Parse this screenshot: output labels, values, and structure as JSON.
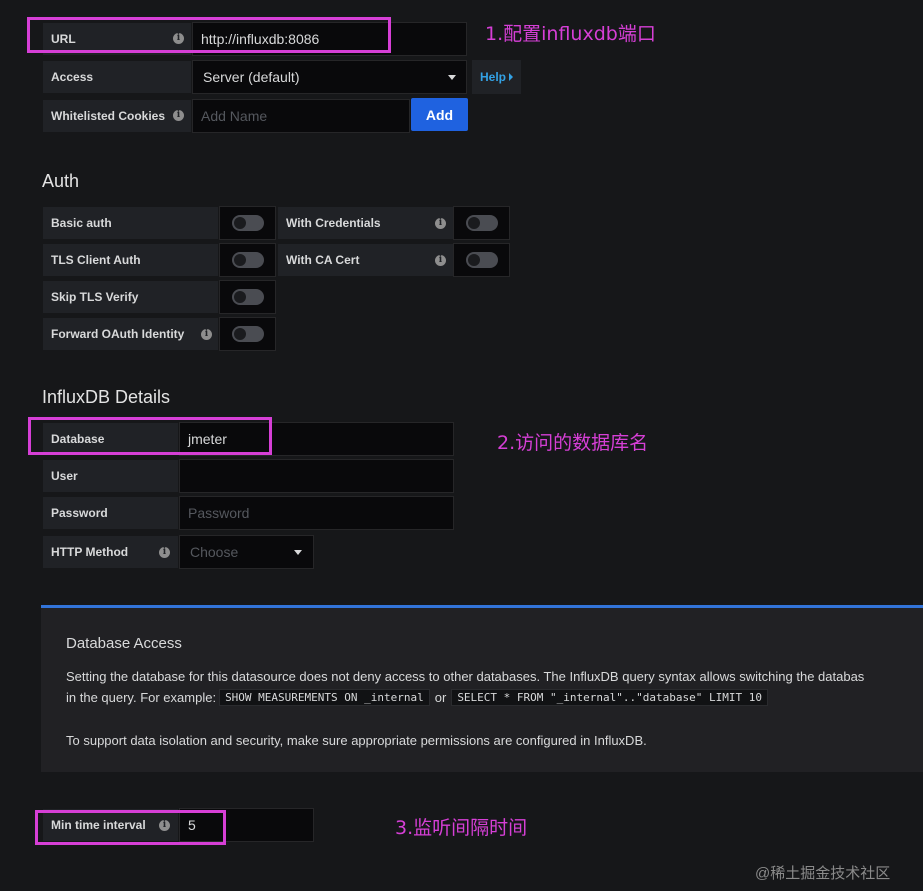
{
  "http": {
    "url_label": "URL",
    "url_value": "http://influxdb:8086",
    "access_label": "Access",
    "access_value": "Server (default)",
    "help_label": "Help",
    "cookies_label": "Whitelisted Cookies",
    "cookies_placeholder": "Add Name",
    "add_label": "Add"
  },
  "auth": {
    "heading": "Auth",
    "basic_auth": "Basic auth",
    "with_credentials": "With Credentials",
    "tls_client_auth": "TLS Client Auth",
    "with_ca_cert": "With CA Cert",
    "skip_tls_verify": "Skip TLS Verify",
    "forward_oauth": "Forward OAuth Identity"
  },
  "influx": {
    "heading": "InfluxDB Details",
    "database_label": "Database",
    "database_value": "jmeter",
    "user_label": "User",
    "user_value": "",
    "password_label": "Password",
    "password_placeholder": "Password",
    "method_label": "HTTP Method",
    "method_placeholder": "Choose"
  },
  "access_box": {
    "title": "Database Access",
    "line1": "Setting the database for this datasource does not deny access to other databases. The InfluxDB query syntax allows switching the databas",
    "line2_prefix": "in the query. For example:",
    "code1": "SHOW MEASUREMENTS ON _internal",
    "or": "or",
    "code2": "SELECT * FROM \"_internal\"..\"database\" LIMIT 10",
    "line3": "To support data isolation and security, make sure appropriate permissions are configured in InfluxDB."
  },
  "interval": {
    "label": "Min time interval",
    "value": "5"
  },
  "annotations": {
    "a1": "1.配置influxdb端口",
    "a2": "2.访问的数据库名",
    "a3": "3.监听间隔时间"
  },
  "watermark": "@稀土掘金技术社区",
  "colors": {
    "annotation": "#d63fd6",
    "add_button": "#1f62e0",
    "help_link": "#33a2e5",
    "access_box_border": "#3274d9"
  },
  "icons": [
    "info-icon",
    "caret-down-icon",
    "caret-right-icon"
  ]
}
